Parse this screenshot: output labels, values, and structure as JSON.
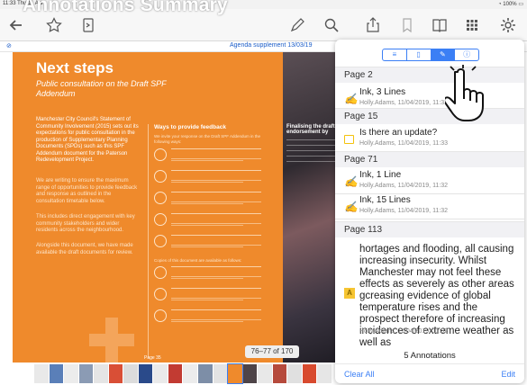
{
  "status": {
    "time": "11:33",
    "date": "Thu 11 Apr",
    "battery": "100%"
  },
  "overlay_title": "Annotations Summary",
  "page_header": {
    "label": "Agenda supplement 13/03/19"
  },
  "toolbar": {
    "icons": [
      "back-arrow-icon",
      "star-icon",
      "reflow-icon",
      "pen-icon",
      "search-icon",
      "share-icon",
      "bookmark-icon",
      "book-icon",
      "grid-icon",
      "settings-icon"
    ]
  },
  "document": {
    "heading": "Next steps",
    "subheading": "Public consultation on the Draft SPF Addendum",
    "para1": "Manchester City Council's Statement of Community Involvement (2015) sets out its expectations for public consultation in the production of Supplementary Planning Documents (SPDs) such as this SPF Addendum document for the Paterson Redevelopment Project.",
    "para2": "We are writing to ensure the maximum range of opportunities to provide feedback and response as outlined in the consultation timetable below.",
    "para3": "This includes direct engagement with key community stakeholders and wider residents across the neighbourhood.",
    "para4": "Alongside this document, we have made available the draft documents for review.",
    "feedback_title": "Ways to provide feedback",
    "feedback_intro": "We invite your response on the Draft SPF Addendum in the following ways:",
    "copies_note": "Copies of this document are available as follows:",
    "right_title": "Finalising the draft endorsement by",
    "page_num": "Page 35"
  },
  "page_counter": "76–77 of 170",
  "panel": {
    "segments": [
      "≡",
      "▯",
      "✎",
      "ⓘ"
    ],
    "sections": [
      {
        "page": "Page 2",
        "title": "Ink, 3 Lines",
        "meta": "Holly.Adams, 11/04/2019, 11:33"
      },
      {
        "page": "Page 15",
        "title": "Is there an update?",
        "meta": "Holly.Adams, 11/04/2019, 11:33"
      },
      {
        "page": "Page 71",
        "title": "Ink, 1 Line",
        "meta": "Holly.Adams, 11/04/2019, 11:32"
      },
      {
        "page": "Page 71",
        "title": "Ink, 15 Lines",
        "meta": "Holly.Adams, 11/04/2019, 11:32"
      },
      {
        "page": "Page 113",
        "title": "hortages and flooding, all causing increasing insecurity. Whilst Manchester may not feel these effects as severely as other areas gcreasing evidence of global temperature rises and the prospect therefore of increasing incidences of extreme weather as well as",
        "meta": "Holly.Adams, 11/04/2019, 11:32"
      }
    ],
    "count": "5 Annotations",
    "clear_all": "Clear All",
    "edit": "Edit"
  },
  "colors": {
    "accent": "#3b7ff5",
    "doc_orange": "#ef8a2c",
    "ink": "#8a3fd1",
    "note": "#f4c20d"
  }
}
